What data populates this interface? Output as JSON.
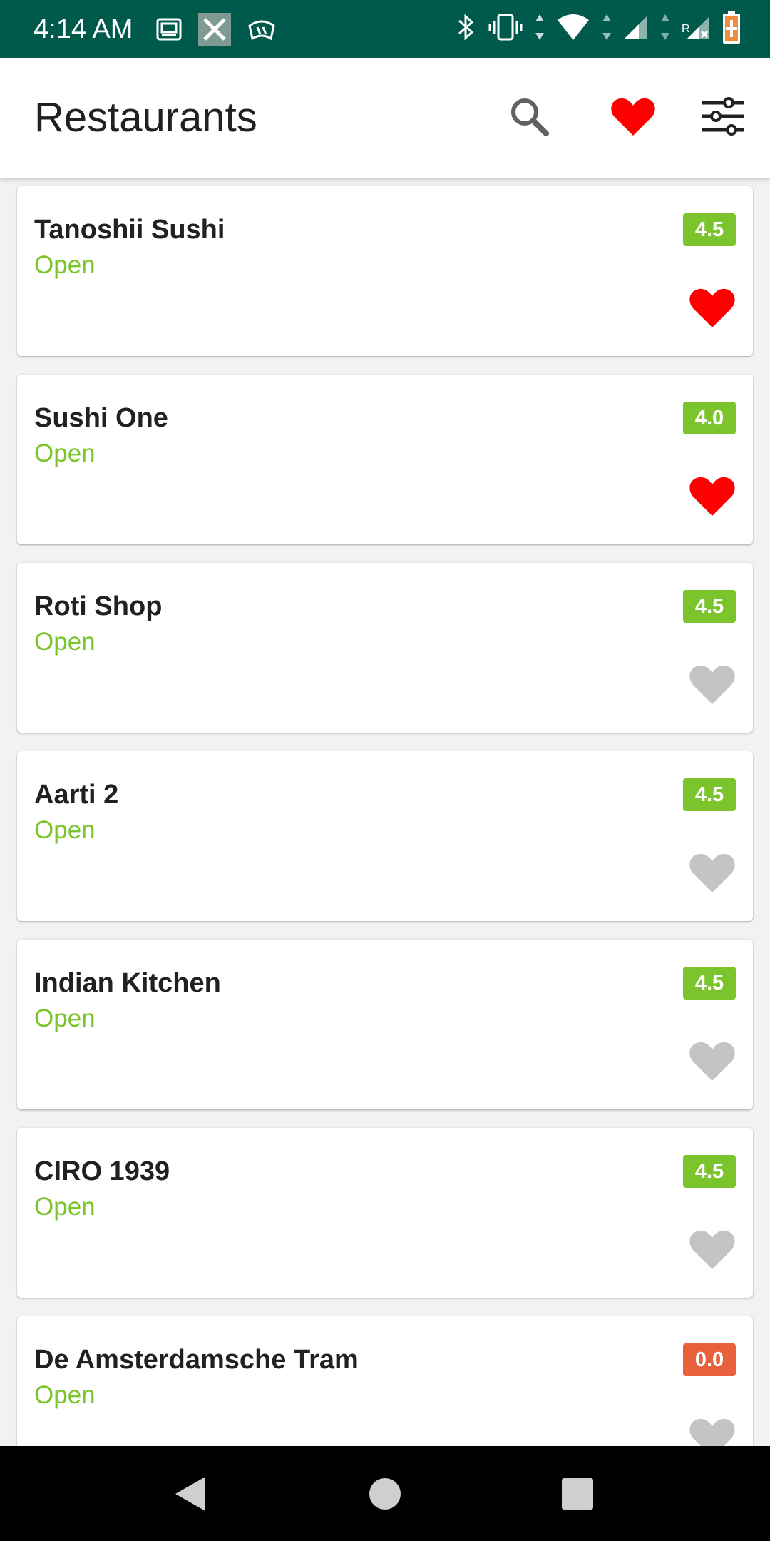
{
  "status_bar": {
    "time": "4:14 AM",
    "left_icons": [
      "photo-notification-icon",
      "x-notification-icon",
      "signal-app-icon"
    ],
    "right_icons": [
      "bluetooth-icon",
      "vibrate-icon",
      "wifi-icon",
      "cell-signal-icon",
      "cell-signal-roaming-icon",
      "battery-charging-icon"
    ],
    "roaming_label": "R"
  },
  "app_bar": {
    "title": "Restaurants",
    "actions": [
      "search-icon",
      "favorites-heart-icon",
      "filter-sliders-icon"
    ]
  },
  "restaurants": [
    {
      "name": "Tanoshii Sushi",
      "status": "Open",
      "rating": "4.5",
      "favorite": true
    },
    {
      "name": "Sushi One",
      "status": "Open",
      "rating": "4.0",
      "favorite": true
    },
    {
      "name": "Roti Shop",
      "status": "Open",
      "rating": "4.5",
      "favorite": false
    },
    {
      "name": "Aarti 2",
      "status": "Open",
      "rating": "4.5",
      "favorite": false
    },
    {
      "name": "Indian Kitchen",
      "status": "Open",
      "rating": "4.5",
      "favorite": false
    },
    {
      "name": "CIRO 1939",
      "status": "Open",
      "rating": "4.5",
      "favorite": false
    },
    {
      "name": "De Amsterdamsche Tram",
      "status": "Open",
      "rating": "0.0",
      "favorite": false
    }
  ],
  "colors": {
    "status_bar": "#005a4c",
    "open_text": "#7bc42b",
    "rating_good": "#7bc42b",
    "rating_bad": "#e8603c",
    "favorite_on": "#ff0000",
    "favorite_off": "#c4c4c4"
  },
  "nav_bar": {
    "buttons": [
      "back-triangle-icon",
      "home-circle-icon",
      "recents-square-icon"
    ]
  }
}
